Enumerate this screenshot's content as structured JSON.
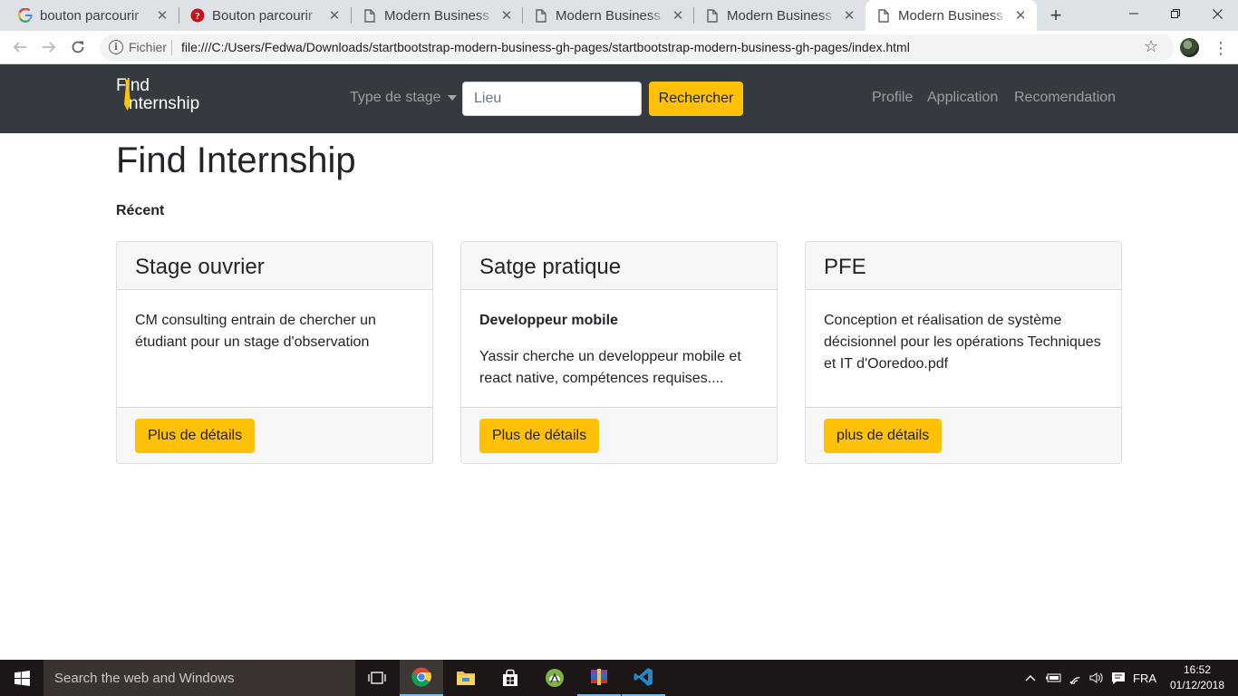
{
  "browser": {
    "tabs": [
      {
        "title": "bouton parcourir",
        "favicon": "google-icon",
        "active": false
      },
      {
        "title": "Bouton parcourir",
        "favicon": "quora-icon",
        "active": false
      },
      {
        "title": "Modern Business",
        "favicon": "page-icon",
        "active": false
      },
      {
        "title": "Modern Business",
        "favicon": "page-icon",
        "active": false
      },
      {
        "title": "Modern Business",
        "favicon": "page-icon",
        "active": false
      },
      {
        "title": "Modern Business",
        "favicon": "page-icon",
        "active": true
      }
    ],
    "address": {
      "scheme_label": "Fichier",
      "url": "file:///C:/Users/Fedwa/Downloads/startbootstrap-modern-business-gh-pages/startbootstrap-modern-business-gh-pages/index.html"
    }
  },
  "navbar": {
    "brand_line1": "Find",
    "brand_line2": "nternship",
    "dropdown_label": "Type de stage",
    "search_placeholder": "Lieu",
    "search_button": "Rechercher",
    "links": [
      "Profile",
      "Application",
      "Recomendation"
    ]
  },
  "page": {
    "title": "Find Internship",
    "section_label": "Récent",
    "cards": [
      {
        "header": "Stage ouvrier",
        "subtitle": "",
        "text": "CM consulting entrain de chercher un étudiant pour un stage d'observation",
        "button": "Plus de détails"
      },
      {
        "header": "Satge pratique",
        "subtitle": "Developpeur mobile",
        "text": "Yassir cherche un developpeur mobile et react native, compétences requises....",
        "button": "Plus de détails"
      },
      {
        "header": "PFE",
        "subtitle": "",
        "text": "Conception et réalisation de système décisionnel pour les opérations Techniques et IT d'Ooredoo.pdf",
        "button": "plus de détails"
      }
    ]
  },
  "taskbar": {
    "search_placeholder": "Search the web and Windows",
    "language": "FRA",
    "time": "16:52",
    "date": "01/12/2018"
  },
  "colors": {
    "navbar_bg": "#343a40",
    "accent_warning": "#ffc107",
    "tab_strip_bg": "#dee1e6"
  }
}
